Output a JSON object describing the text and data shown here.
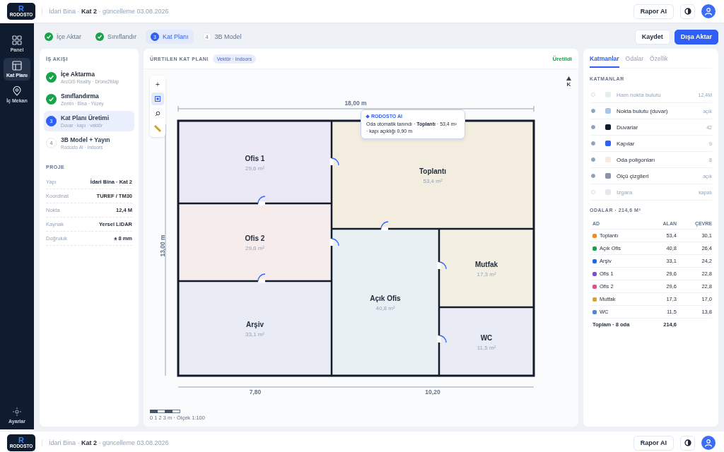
{
  "header": {
    "logo": {
      "mark": "R",
      "name": "RODOSTO"
    },
    "breadcrumb": "İdari Bina · **Kat 2** · güncelleme 03.08.2026",
    "report_button": "Rapor AI"
  },
  "sidebar": {
    "items": [
      {
        "kind": "grid",
        "label": "Panel",
        "selected": false
      },
      {
        "kind": "layout",
        "label": "Kat Planı",
        "selected": true
      },
      {
        "kind": "pin",
        "label": "İç Mekan",
        "selected": false
      }
    ],
    "settings": {
      "label": "Ayarlar"
    }
  },
  "stepper": [
    {
      "label": "İçe Aktar",
      "done": true,
      "selected": false
    },
    {
      "label": "Sınıflandır",
      "done": true,
      "selected": false
    },
    {
      "number": "3",
      "label": "Kat Planı",
      "done": false,
      "selected": true
    },
    {
      "number": "4",
      "label": "3B Model",
      "done": false,
      "selected": false
    }
  ],
  "actions": {
    "save": "Kaydet",
    "export": "Dışa Aktar"
  },
  "workflow": {
    "title": "İŞ AKIŞI",
    "steps": [
      {
        "title": "İçe Aktarma",
        "subtitle": "ArcGIS Reality · Drone2Map",
        "done": true,
        "selected": false
      },
      {
        "title": "Sınıflandırma",
        "subtitle": "Zemin · Bina · Yüzey",
        "done": true,
        "selected": false
      },
      {
        "number": "3",
        "title": "Kat Planı Üretimi",
        "subtitle": "Duvar · kapı · vektör",
        "done": false,
        "selected": true
      },
      {
        "number": "4",
        "title": "3B Model + Yayın",
        "subtitle": "Rodosto AI · Indoors",
        "done": false,
        "selected": false
      }
    ]
  },
  "project": {
    "title": "PROJE",
    "rows": [
      {
        "key": "Yapı",
        "value": "İdari Bina · Kat 2"
      },
      {
        "key": "Koordinat",
        "value": "TUREF / TM30"
      },
      {
        "key": "Nokta",
        "value": "12,4 M"
      },
      {
        "key": "Kaynak",
        "value": "Yersel LiDAR"
      },
      {
        "key": "Doğruluk",
        "value": "± 8 mm"
      }
    ]
  },
  "plan": {
    "title": "ÜRETILEN KAT PLANI",
    "tag": "Vektör · Indoors",
    "status": "Üretildi",
    "tools": [
      {
        "kind": "zoom",
        "label": "+",
        "selected": false
      },
      {
        "kind": "select",
        "selected": true
      },
      {
        "kind": "search",
        "selected": false
      },
      {
        "kind": "ruler",
        "selected": false
      }
    ],
    "north": "K",
    "dimensions": {
      "width": "18,00 m",
      "height": "13,00 m",
      "segments": [
        "7,80",
        "10,20"
      ]
    },
    "rooms": [
      {
        "name": "Ofis 1",
        "area": "29,6 m²",
        "color": "#ebe9f5"
      },
      {
        "name": "Toplantı",
        "area": "53,4 m²",
        "color": "#f3ede0"
      },
      {
        "name": "Ofis 2",
        "area": "29,6 m²",
        "color": "#f6ecec"
      },
      {
        "name": "Arşiv",
        "area": "33,1 m²",
        "color": "#e9ecf4"
      },
      {
        "name": "Açık Ofis",
        "area": "40,8 m²",
        "color": "#e8f0f3"
      },
      {
        "name": "Mutfak",
        "area": "17,3 m²",
        "color": "#f3efe3"
      },
      {
        "name": "WC",
        "area": "11,5 m²",
        "color": "#e9ecf4"
      }
    ],
    "tooltip": {
      "title": "RODOSTO AI",
      "text": "Oda otomatik tanındı · **Toplantı** · 53,4 m² · kapı açıklığı 0,90 m"
    },
    "scale": "0 1 2 3 m · Ölçek 1:100"
  },
  "inspector": {
    "tabs": [
      {
        "label": "Katmanlar",
        "selected": true
      },
      {
        "label": "Odalar",
        "selected": false
      },
      {
        "label": "Özellik",
        "selected": false
      }
    ],
    "layers_title": "KATMANLAR",
    "layers": [
      {
        "name": "Ham nokta bulutu",
        "value": "12,4M",
        "color": "#e3eef0",
        "visible": false
      },
      {
        "name": "Nokta bulutu (duvar)",
        "value": "açık",
        "color": "#a9c6ea",
        "visible": true
      },
      {
        "name": "Duvarlar",
        "value": "42",
        "color": "#111b2b",
        "visible": true
      },
      {
        "name": "Kapılar",
        "value": "9",
        "color": "#2f5ff5",
        "visible": true
      },
      {
        "name": "Oda poligonları",
        "value": "8",
        "color": "#f4ece0",
        "visible": true
      },
      {
        "name": "Ölçü çizgileri",
        "value": "açık",
        "color": "#8a94a6",
        "visible": true
      },
      {
        "name": "Izgara",
        "value": "kapalı",
        "color": "#e4e8f0",
        "visible": false
      }
    ],
    "rooms_title": "ODALAR · 214,6 M²",
    "columns": [
      "AD",
      "ALAN",
      "ÇEVRE"
    ],
    "rows": [
      {
        "name": "Toplantı",
        "area": "53,4",
        "perimeter": "30,1",
        "color": "#f28c18"
      },
      {
        "name": "Açık Ofis",
        "area": "40,8",
        "perimeter": "26,4",
        "color": "#16a34a"
      },
      {
        "name": "Arşiv",
        "area": "33,1",
        "perimeter": "24,2",
        "color": "#2563eb"
      },
      {
        "name": "Ofis 1",
        "area": "29,6",
        "perimeter": "22,8",
        "color": "#7c4dd6"
      },
      {
        "name": "Ofis 2",
        "area": "29,6",
        "perimeter": "22,8",
        "color": "#db4f8a"
      },
      {
        "name": "Mutfak",
        "area": "17,3",
        "perimeter": "17,0",
        "color": "#d4a23a"
      },
      {
        "name": "WC",
        "area": "11,5",
        "perimeter": "13,8",
        "color": "#4f87d6"
      }
    ],
    "total": {
      "label": "Toplam · 8 oda",
      "area": "214,6"
    }
  },
  "footer_header": {
    "logo": {
      "mark": "R",
      "name": "RODOSTO"
    },
    "breadcrumb": "İdari Bina · **Kat 2** · güncelleme 03.08.2026",
    "report_button": "Rapor AI"
  }
}
